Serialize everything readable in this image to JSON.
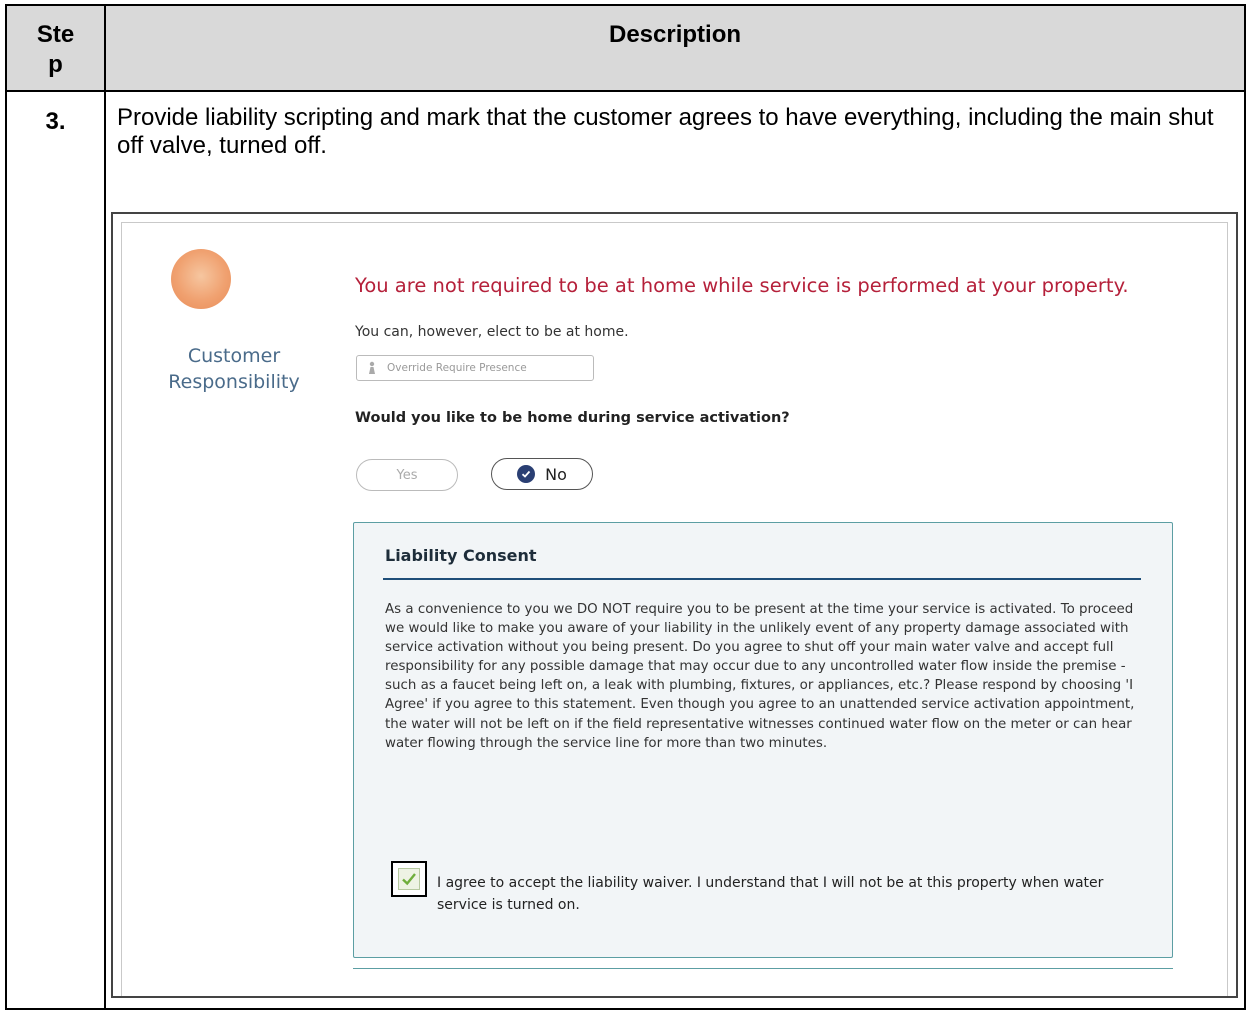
{
  "table": {
    "header_step": "Ste\np",
    "header_description": "Description",
    "step_number": "3.",
    "step_instruction": "Provide liability scripting and mark that the customer agrees to have everything, including the main shut off valve, turned off."
  },
  "screen": {
    "sidebar_label": "Customer Responsibility",
    "headline": "You are not required to be at home while service is performed at your property.",
    "subline": "You can, however, elect to be at home.",
    "override_button": "Override Require Presence",
    "question": "Would you like to be home during service activation?",
    "yes_label": "Yes",
    "no_label": "No",
    "selected_option": "No",
    "consent_title": "Liability Consent",
    "consent_body": "As a convenience to you we DO NOT require you to be present at the time your service is activated. To proceed we would like to make you aware of your liability in the unlikely event of any property damage associated with service activation without you being present. Do you agree to shut off your main water valve and accept full responsibility for any possible damage that may occur due to any uncontrolled water flow inside the premise - such as a faucet being left on, a leak with plumbing, fixtures, or appliances, etc.? Please respond by choosing 'I Agree' if you agree to this statement. Even though you agree to an unattended service activation appointment, the water will not be left on if the field representative witnesses continued water flow on the meter or can hear water flowing through the service line for more than two minutes.",
    "agree_label": "I agree to accept the liability waiver. I understand that I will not be at this property when water service is turned on.",
    "agree_checked": true
  },
  "colors": {
    "headline": "#b5203a",
    "header_fill": "#d9d9d9",
    "selected_dot": "#2a3f73",
    "rule": "#1f4e79",
    "panel_border": "#5c9ea3"
  },
  "icons": {
    "avatar": "customer-avatar-icon",
    "override": "person-icon",
    "selected": "check-circle-icon",
    "agree": "checkmark-icon"
  }
}
